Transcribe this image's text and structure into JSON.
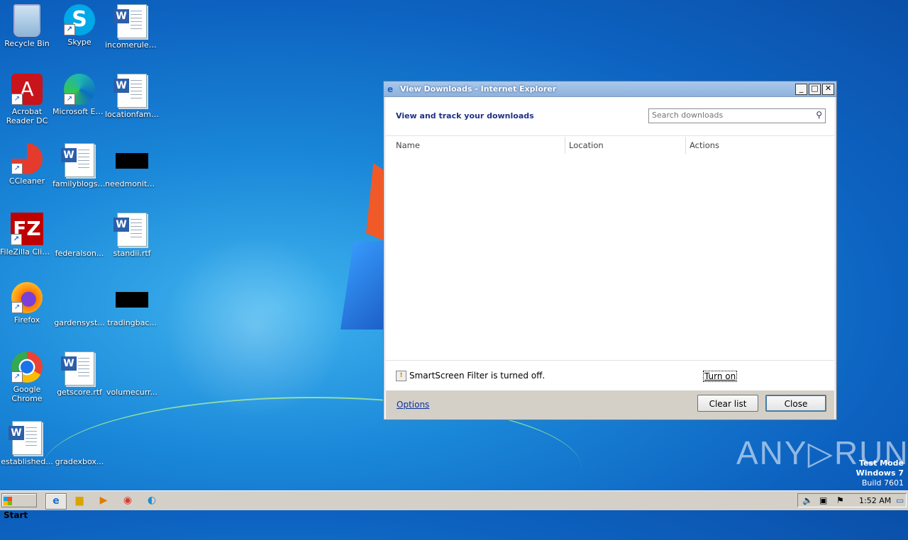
{
  "desktop": {
    "icons": [
      {
        "label": "Recycle Bin"
      },
      {
        "label": "Skype"
      },
      {
        "label": "incomerules..."
      },
      {
        "label": "Acrobat Reader DC"
      },
      {
        "label": "Microsoft Edge"
      },
      {
        "label": "locationfami..."
      },
      {
        "label": "CCleaner"
      },
      {
        "label": "familyblogs.rtf"
      },
      {
        "label": "needmonito..."
      },
      {
        "label": "FileZilla Client"
      },
      {
        "label": "federalson..."
      },
      {
        "label": "standii.rtf"
      },
      {
        "label": "Firefox"
      },
      {
        "label": "gardensyst..."
      },
      {
        "label": "tradingbac..."
      },
      {
        "label": "Google Chrome"
      },
      {
        "label": "getscore.rtf"
      },
      {
        "label": "volumecurr..."
      },
      {
        "label": "established..."
      },
      {
        "label": "gradexbox..."
      }
    ]
  },
  "dialog": {
    "title": "View Downloads - Internet Explorer",
    "heading": "View and track your downloads",
    "search_placeholder": "Search downloads",
    "columns": {
      "name": "Name",
      "location": "Location",
      "actions": "Actions"
    },
    "smartscreen_text": "SmartScreen Filter is turned off.",
    "turn_on_label": "Turn on",
    "options_label": "Options",
    "clear_list_label": "Clear list",
    "close_label": "Close"
  },
  "watermark": {
    "text": "ANY▷RUN"
  },
  "os_info": {
    "line1": "Test Mode",
    "line2": "Windows 7",
    "line3": "Build 7601"
  },
  "taskbar": {
    "start_label": "Start",
    "clock": "1:52 AM",
    "apps": [
      "internet-explorer",
      "file-explorer",
      "media-player",
      "chrome",
      "edge"
    ]
  }
}
